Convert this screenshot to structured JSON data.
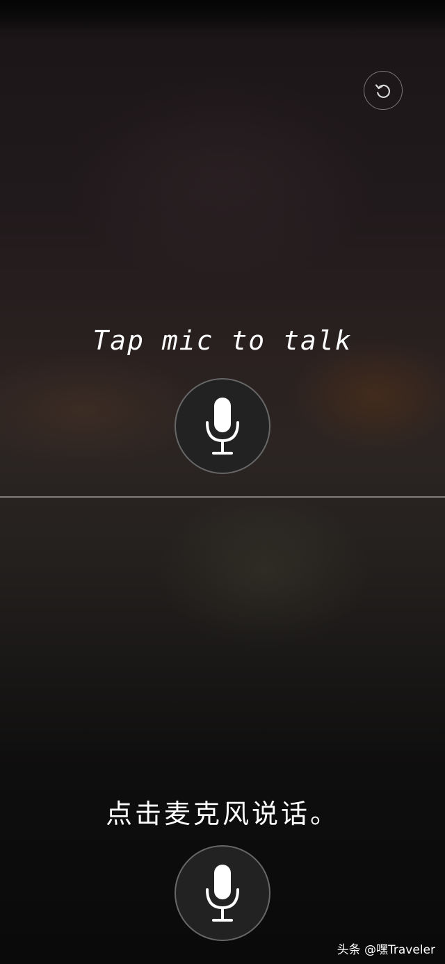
{
  "upper": {
    "prompt": "Tap mic to talk",
    "mic_icon": "microphone-icon",
    "reset_icon": "rotate-ccw-icon"
  },
  "lower": {
    "prompt": "点击麦克风说话。",
    "mic_icon": "microphone-icon"
  },
  "watermark": "头条 @嘿Traveler",
  "colors": {
    "text": "#ffffff",
    "mic_button_bg": "#232223",
    "divider": "#c8c8c8"
  }
}
